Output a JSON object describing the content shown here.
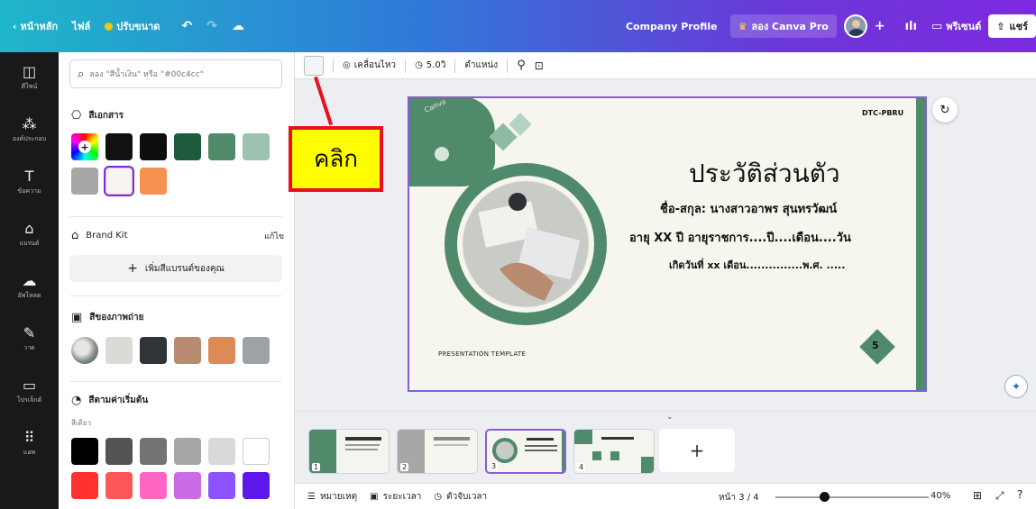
{
  "topbar": {
    "home": "หน้าหลัก",
    "file": "ไฟล์",
    "resize": "ปรับขนาด",
    "doc_title": "Company Profile",
    "try_pro": "ลอง Canva Pro",
    "present": "พรีเซนต์",
    "share": "แชร์"
  },
  "rail": [
    {
      "icon": "template-icon",
      "glyph": "◫",
      "label": "ดีไซน์"
    },
    {
      "icon": "elements-icon",
      "glyph": "⁂",
      "label": "องค์ประกอบ"
    },
    {
      "icon": "text-icon",
      "glyph": "T",
      "label": "ข้อความ"
    },
    {
      "icon": "brand-icon",
      "glyph": "⌂",
      "label": "แบรนด์"
    },
    {
      "icon": "upload-icon",
      "glyph": "☁",
      "label": "อัพโหลด"
    },
    {
      "icon": "draw-icon",
      "glyph": "✎",
      "label": "วาด"
    },
    {
      "icon": "projects-icon",
      "glyph": "▭",
      "label": "โปรเจ็กต์"
    },
    {
      "icon": "apps-icon",
      "glyph": "⠿",
      "label": "แอพ"
    }
  ],
  "panel": {
    "search_placeholder": "ลอง \"สีน้ำเงิน\" หรือ \"#00c4cc\"",
    "doc_colors_title": "สีเอกสาร",
    "doc_colors": [
      "#111111",
      "#0d0d0d",
      "#1e5a3c",
      "#4f8a6b",
      "#9dc2b0",
      "#a7a7a7",
      "#f5f4ef",
      "#f5924f"
    ],
    "brand_kit_title": "Brand Kit",
    "brand_kit_edit": "แก้ไข",
    "add_brand": "เพิ่มสีแบรนด์ของคุณ",
    "photo_colors_title": "สีของภาพถ่าย",
    "photo_colors": [
      "#dadad6",
      "#2f3437",
      "#b98b70",
      "#dc8a56",
      "#9ea2a4"
    ],
    "default_colors_title": "สีตามค่าเริ่มต้น",
    "solid_label": "สีเดียว",
    "default_row1": [
      "#000000",
      "#545454",
      "#737373",
      "#a6a6a6",
      "#d9d9d9",
      "#ffffff"
    ],
    "default_row2": [
      "#ff3131",
      "#ff5757",
      "#ff66c4",
      "#cb6ce6",
      "#8c52ff",
      "#5e17eb"
    ]
  },
  "toolbar": {
    "animate": "เคลื่อนไหว",
    "duration": "5.0วิ",
    "position": "ตำแหน่ง"
  },
  "slide": {
    "code": "DTC-PBRU",
    "title": "ประวัติส่วนตัว",
    "line1": "ชื่อ-สกุล: นางสาวอาพร สุนทรวัฒน์",
    "line2": "อายุ  XX  ปี อายุราชการ....ปี....เดือน....วัน",
    "line3": "เกิดวันที่ xx เดือน...............พ.ศ. .....",
    "footer": "PRESENTATION TEMPLATE",
    "page_badge": "5",
    "watermark": "Canva",
    "green": "#4f8a6b"
  },
  "callout": {
    "text": "คลิก"
  },
  "pages": [
    "1",
    "2",
    "3",
    "4"
  ],
  "bottom": {
    "notes": "หมายเหตุ",
    "duration": "ระยะเวลา",
    "timer": "ตัวจับเวลา",
    "page": "หน้า 3 / 4",
    "zoom": "40%"
  }
}
